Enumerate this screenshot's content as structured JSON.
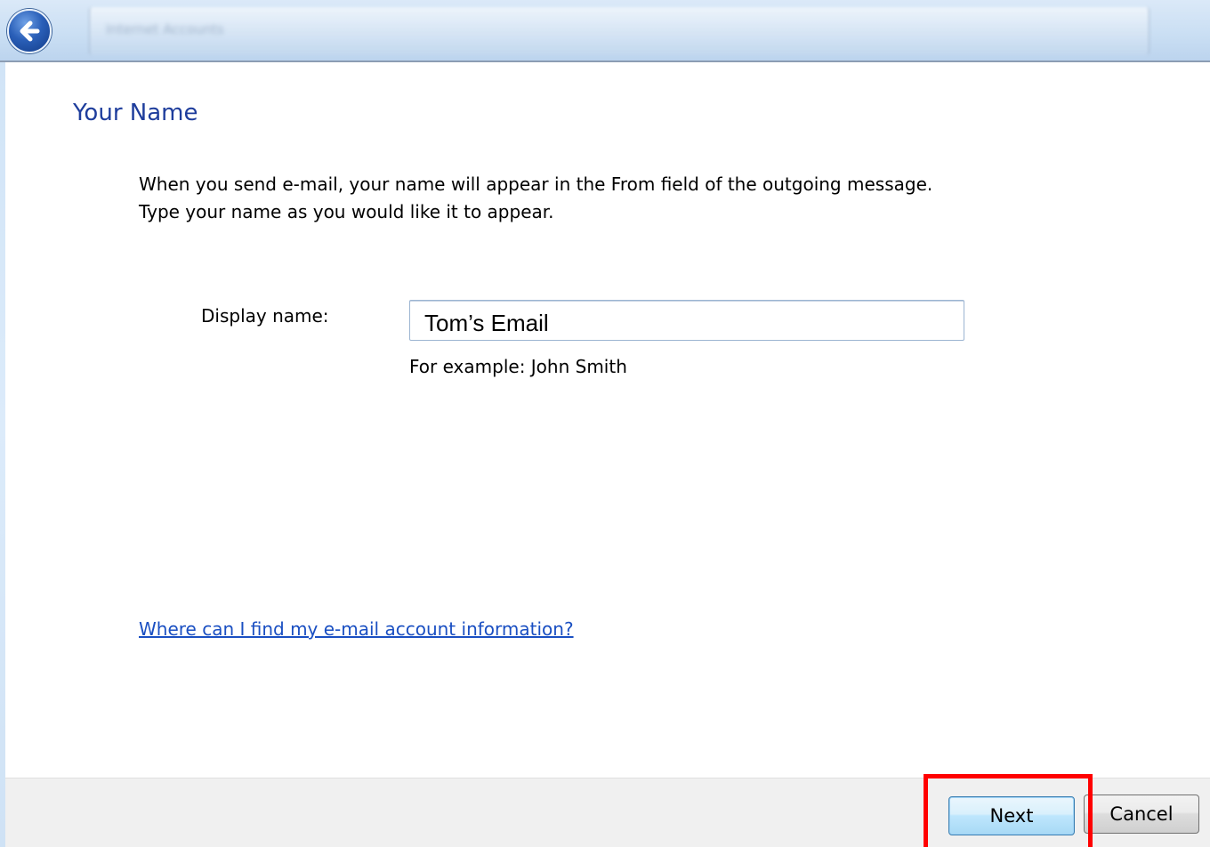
{
  "window": {
    "title": "Internet Accounts"
  },
  "page": {
    "title": "Your Name",
    "description_line1": "When you send e-mail, your name will appear in the From field of the outgoing message.",
    "description_line2": "Type your name as you would like it to appear."
  },
  "form": {
    "display_name_label": "Display name:",
    "display_name_value": "Tom’s Email",
    "hint": "For example: John Smith"
  },
  "help_link": "Where can I find my e-mail account information?",
  "buttons": {
    "next_label": "Next",
    "cancel_label": "Cancel"
  },
  "icons": {
    "back": "back-arrow-icon"
  },
  "colors": {
    "title": "#1e3d9c",
    "link": "#1a4fc2",
    "highlight": "#ff0000"
  }
}
